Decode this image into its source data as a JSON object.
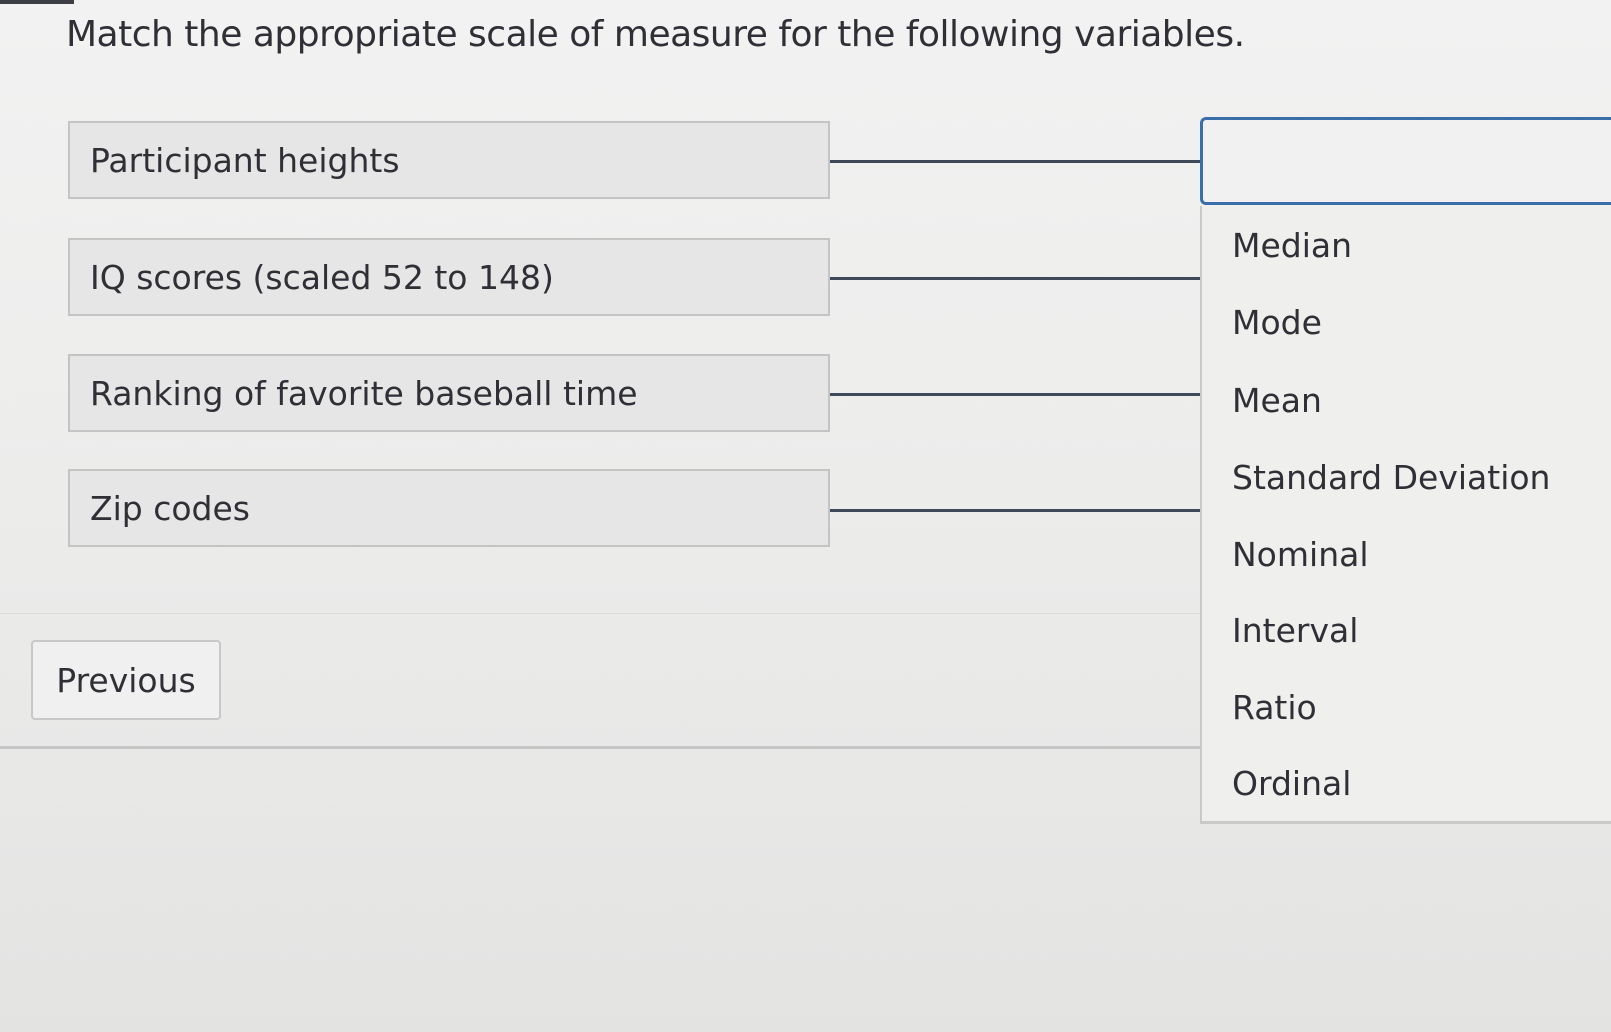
{
  "question": "Match the appropriate scale of measure for the following variables.",
  "prompts": [
    "Participant heights",
    "IQ scores (scaled 52 to 148)",
    "Ranking of favorite baseball time",
    "Zip codes"
  ],
  "answer_slot": {
    "value": ""
  },
  "options": [
    "Median",
    "Mode",
    "Mean",
    "Standard Deviation",
    "Nominal",
    "Interval",
    "Ratio",
    "Ordinal"
  ],
  "navigation": {
    "previous_label": "Previous"
  },
  "colors": {
    "focus_border": "#3a6ea8",
    "connector": "#3e4a5a"
  }
}
